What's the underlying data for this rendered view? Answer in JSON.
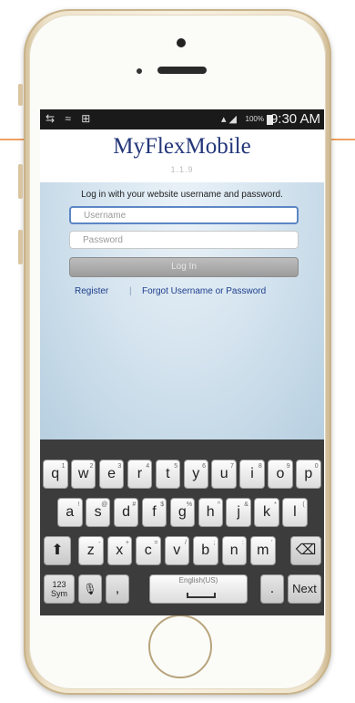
{
  "status_bar": {
    "left_icons": "⇆ ≈ ⊞",
    "right_icons": "▴ ◢",
    "battery": "100%",
    "time": "9:30 AM"
  },
  "app": {
    "title": "MyFlexMobile",
    "version": "1.1.9"
  },
  "login": {
    "prompt": "Log in with your website username and password.",
    "username_placeholder": "Username",
    "password_placeholder": "Password",
    "login_button": "Log In",
    "register_link": "Register",
    "separator": "|",
    "forgot_link": "Forgot Username or Password"
  },
  "keyboard": {
    "row1": [
      {
        "k": "q",
        "h": "1"
      },
      {
        "k": "w",
        "h": "2"
      },
      {
        "k": "e",
        "h": "3"
      },
      {
        "k": "r",
        "h": "4"
      },
      {
        "k": "t",
        "h": "5"
      },
      {
        "k": "y",
        "h": "6"
      },
      {
        "k": "u",
        "h": "7"
      },
      {
        "k": "i",
        "h": "8"
      },
      {
        "k": "o",
        "h": "9"
      },
      {
        "k": "p",
        "h": "0"
      }
    ],
    "row2": [
      {
        "k": "a",
        "h": "!"
      },
      {
        "k": "s",
        "h": "@"
      },
      {
        "k": "d",
        "h": "#"
      },
      {
        "k": "f",
        "h": "$"
      },
      {
        "k": "g",
        "h": "%"
      },
      {
        "k": "h",
        "h": "^"
      },
      {
        "k": "j",
        "h": "&"
      },
      {
        "k": "k",
        "h": "*"
      },
      {
        "k": "l",
        "h": "("
      }
    ],
    "row3": [
      {
        "k": "z",
        "h": "-"
      },
      {
        "k": "x",
        "h": "+"
      },
      {
        "k": "c",
        "h": "="
      },
      {
        "k": "v",
        "h": "/"
      },
      {
        "k": "b",
        "h": ";"
      },
      {
        "k": "n",
        "h": ":"
      },
      {
        "k": "m",
        "h": "'"
      }
    ],
    "shift": "⬆",
    "backspace": "⌫",
    "sym_line1": "123",
    "sym_line2": "Sym",
    "mic": "🎙",
    "comma": ",",
    "space_label": "English(US)",
    "period": ".",
    "next": "Next"
  }
}
